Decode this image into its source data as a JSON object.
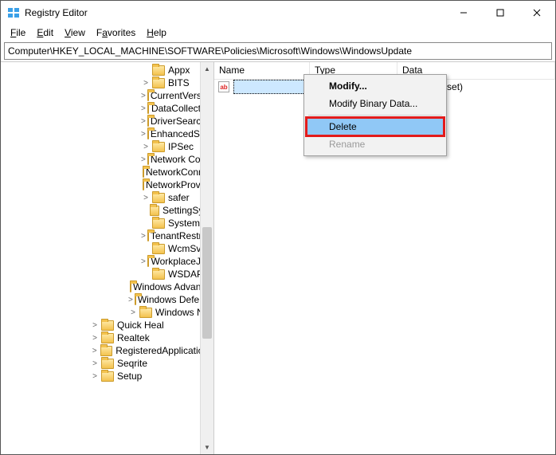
{
  "window": {
    "title": "Registry Editor",
    "buttons": {
      "min": "—",
      "max": "▢",
      "close": "✕"
    }
  },
  "menu": {
    "file": "File",
    "edit": "Edit",
    "view": "View",
    "favorites": "Favorites",
    "help": "Help"
  },
  "address": "Computer\\HKEY_LOCAL_MACHINE\\SOFTWARE\\Policies\\Microsoft\\Windows\\WindowsUpdate",
  "tree": [
    {
      "indent": 11,
      "exp": "",
      "label": "Appx"
    },
    {
      "indent": 11,
      "exp": ">",
      "label": "BITS"
    },
    {
      "indent": 11,
      "exp": ">",
      "label": "CurrentVersion"
    },
    {
      "indent": 11,
      "exp": ">",
      "label": "DataCollection"
    },
    {
      "indent": 11,
      "exp": ">",
      "label": "DriverSearching"
    },
    {
      "indent": 11,
      "exp": ">",
      "label": "EnhancedStorageDevices"
    },
    {
      "indent": 11,
      "exp": ">",
      "label": "IPSec"
    },
    {
      "indent": 11,
      "exp": ">",
      "label": "Network Connections"
    },
    {
      "indent": 11,
      "exp": "",
      "label": "NetworkConnectivityStatusIndicator"
    },
    {
      "indent": 11,
      "exp": "",
      "label": "NetworkProvider"
    },
    {
      "indent": 11,
      "exp": ">",
      "label": "safer"
    },
    {
      "indent": 11,
      "exp": "",
      "label": "SettingSync"
    },
    {
      "indent": 11,
      "exp": "",
      "label": "System"
    },
    {
      "indent": 11,
      "exp": ">",
      "label": "TenantRestrictions"
    },
    {
      "indent": 11,
      "exp": "",
      "label": "WcmSvc"
    },
    {
      "indent": 11,
      "exp": ">",
      "label": "WorkplaceJoin"
    },
    {
      "indent": 11,
      "exp": "",
      "label": "WSDAPI"
    },
    {
      "indent": 10,
      "exp": "",
      "label": "Windows Advanced Threat Protection"
    },
    {
      "indent": 10,
      "exp": ">",
      "label": "Windows Defender"
    },
    {
      "indent": 10,
      "exp": ">",
      "label": "Windows NT"
    },
    {
      "indent": 7,
      "exp": ">",
      "label": "Quick Heal"
    },
    {
      "indent": 7,
      "exp": ">",
      "label": "Realtek"
    },
    {
      "indent": 7,
      "exp": ">",
      "label": "RegisteredApplications"
    },
    {
      "indent": 7,
      "exp": ">",
      "label": "Seqrite"
    },
    {
      "indent": 7,
      "exp": ">",
      "label": "Setup"
    }
  ],
  "columns": {
    "name": "Name",
    "type": "Type",
    "data": "Data"
  },
  "row": {
    "icon": "ab",
    "name": "",
    "type": "",
    "data": "(value not set)"
  },
  "context": {
    "modify": "Modify...",
    "modifyBinary": "Modify Binary Data...",
    "delete": "Delete",
    "rename": "Rename"
  }
}
